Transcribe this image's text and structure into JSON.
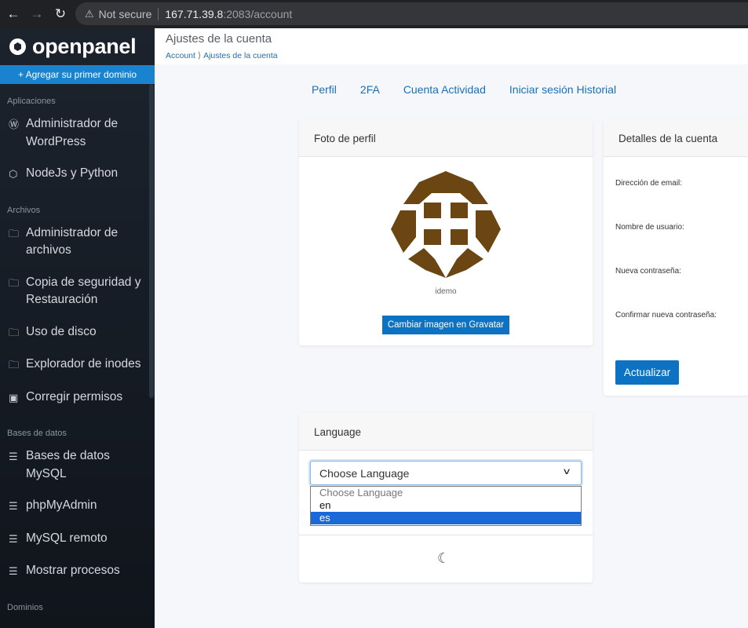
{
  "browser": {
    "security": "Not secure",
    "host": "167.71.39.8",
    "path": ":2083/account"
  },
  "sidebar": {
    "brand": "openpanel",
    "add_domain": "+ Agregar su primer dominio",
    "sections": [
      {
        "label": "Aplicaciones",
        "items": [
          {
            "icon": "wordpress-icon",
            "glyph": "Ⓦ",
            "label": "Administrador de WordPress"
          },
          {
            "icon": "nodejs-icon",
            "glyph": "⬡",
            "label": "NodeJs y Python"
          }
        ]
      },
      {
        "label": "Archivos",
        "items": [
          {
            "icon": "folder-icon",
            "glyph": "🗀",
            "label": "Administrador de archivos"
          },
          {
            "icon": "backup-folder-icon",
            "glyph": "🗀",
            "label": "Copia de seguridad y Restauración"
          },
          {
            "icon": "disk-usage-icon",
            "glyph": "🗀",
            "label": "Uso de disco"
          },
          {
            "icon": "inodes-icon",
            "glyph": "🗀",
            "label": "Explorador de inodes"
          },
          {
            "icon": "permissions-icon",
            "glyph": "▣",
            "label": "Corregir permisos"
          }
        ]
      },
      {
        "label": "Bases de datos",
        "items": [
          {
            "icon": "database-icon",
            "glyph": "☰",
            "label": "Bases de datos MySQL"
          },
          {
            "icon": "phpmyadmin-icon",
            "glyph": "☰",
            "label": "phpMyAdmin"
          },
          {
            "icon": "remote-mysql-icon",
            "glyph": "☰",
            "label": "MySQL remoto"
          },
          {
            "icon": "processes-icon",
            "glyph": "☰",
            "label": "Mostrar procesos"
          }
        ]
      },
      {
        "label": "Dominios",
        "items": []
      }
    ]
  },
  "header": {
    "title": "Ajustes de la cuenta",
    "breadcrumb": [
      "Account",
      "Ajustes de la cuenta"
    ]
  },
  "tabs": [
    "Perfil",
    "2FA",
    "Cuenta Actividad",
    "Iniciar sesión Historial"
  ],
  "photo_card": {
    "title": "Foto de perfil",
    "username": "idemo",
    "button": "Cambiar imagen en Gravatar",
    "avatar_color": "#6b4512"
  },
  "details_card": {
    "title": "Detalles de la cuenta",
    "fields": [
      "Dirección de email:",
      "Nombre de usuario:",
      "Nueva contraseña:",
      "Confirmar nueva contraseña:"
    ],
    "button": "Actualizar"
  },
  "language_card": {
    "title": "Language",
    "selected": "Choose Language",
    "options": [
      "Choose Language",
      "en",
      "es"
    ],
    "highlighted": "es"
  },
  "colors": {
    "accent": "#0d72c1",
    "sidebar_bg": "#1c232d"
  }
}
